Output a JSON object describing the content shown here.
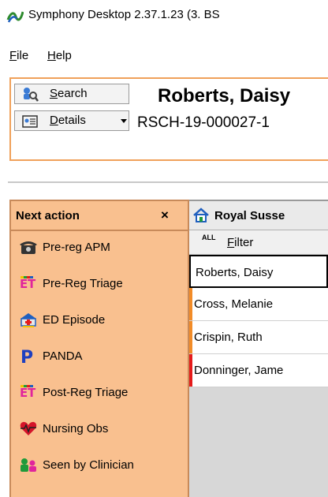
{
  "window": {
    "title": "Symphony Desktop 2.37.1.23 (3. BS"
  },
  "menu": [
    {
      "key": "F",
      "rest": "ile"
    },
    {
      "key": "H",
      "rest": "elp"
    }
  ],
  "toolbar": {
    "search": {
      "key": "S",
      "rest": "earch"
    },
    "details": {
      "key": "D",
      "rest": "etails"
    }
  },
  "patient": {
    "name": "Roberts, Daisy",
    "id": "RSCH-19-000027-1"
  },
  "next_action": {
    "title": "Next action",
    "close": "×",
    "items": [
      {
        "label": "Pre-reg APM",
        "icon": "telephone-icon"
      },
      {
        "label": "Pre-Reg Triage",
        "icon": "et-triage-icon"
      },
      {
        "label": "ED Episode",
        "icon": "ambulance-icon"
      },
      {
        "label": "PANDA",
        "icon": "panda-p-icon"
      },
      {
        "label": "Post-Reg Triage",
        "icon": "et-triage-icon"
      },
      {
        "label": "Nursing Obs",
        "icon": "heart-icon"
      },
      {
        "label": "Seen by Clinician",
        "icon": "clinician-icon"
      }
    ]
  },
  "location": {
    "title": "Royal Susse",
    "icon": "home-icon"
  },
  "filter": {
    "all": "ALL",
    "key": "F",
    "rest": "ilter"
  },
  "patient_list": [
    {
      "name": "Roberts, Daisy",
      "flag": "#ffffff",
      "selected": true
    },
    {
      "name": "Cross, Melanie",
      "flag": "#f28c28"
    },
    {
      "name": "Crispin, Ruth",
      "flag": "#f28c28"
    },
    {
      "name": "Donninger, Jame",
      "flag": "#e51b1b"
    }
  ],
  "colors": {
    "accent": "#f9c08f",
    "panel_border": "#f0a15a"
  }
}
